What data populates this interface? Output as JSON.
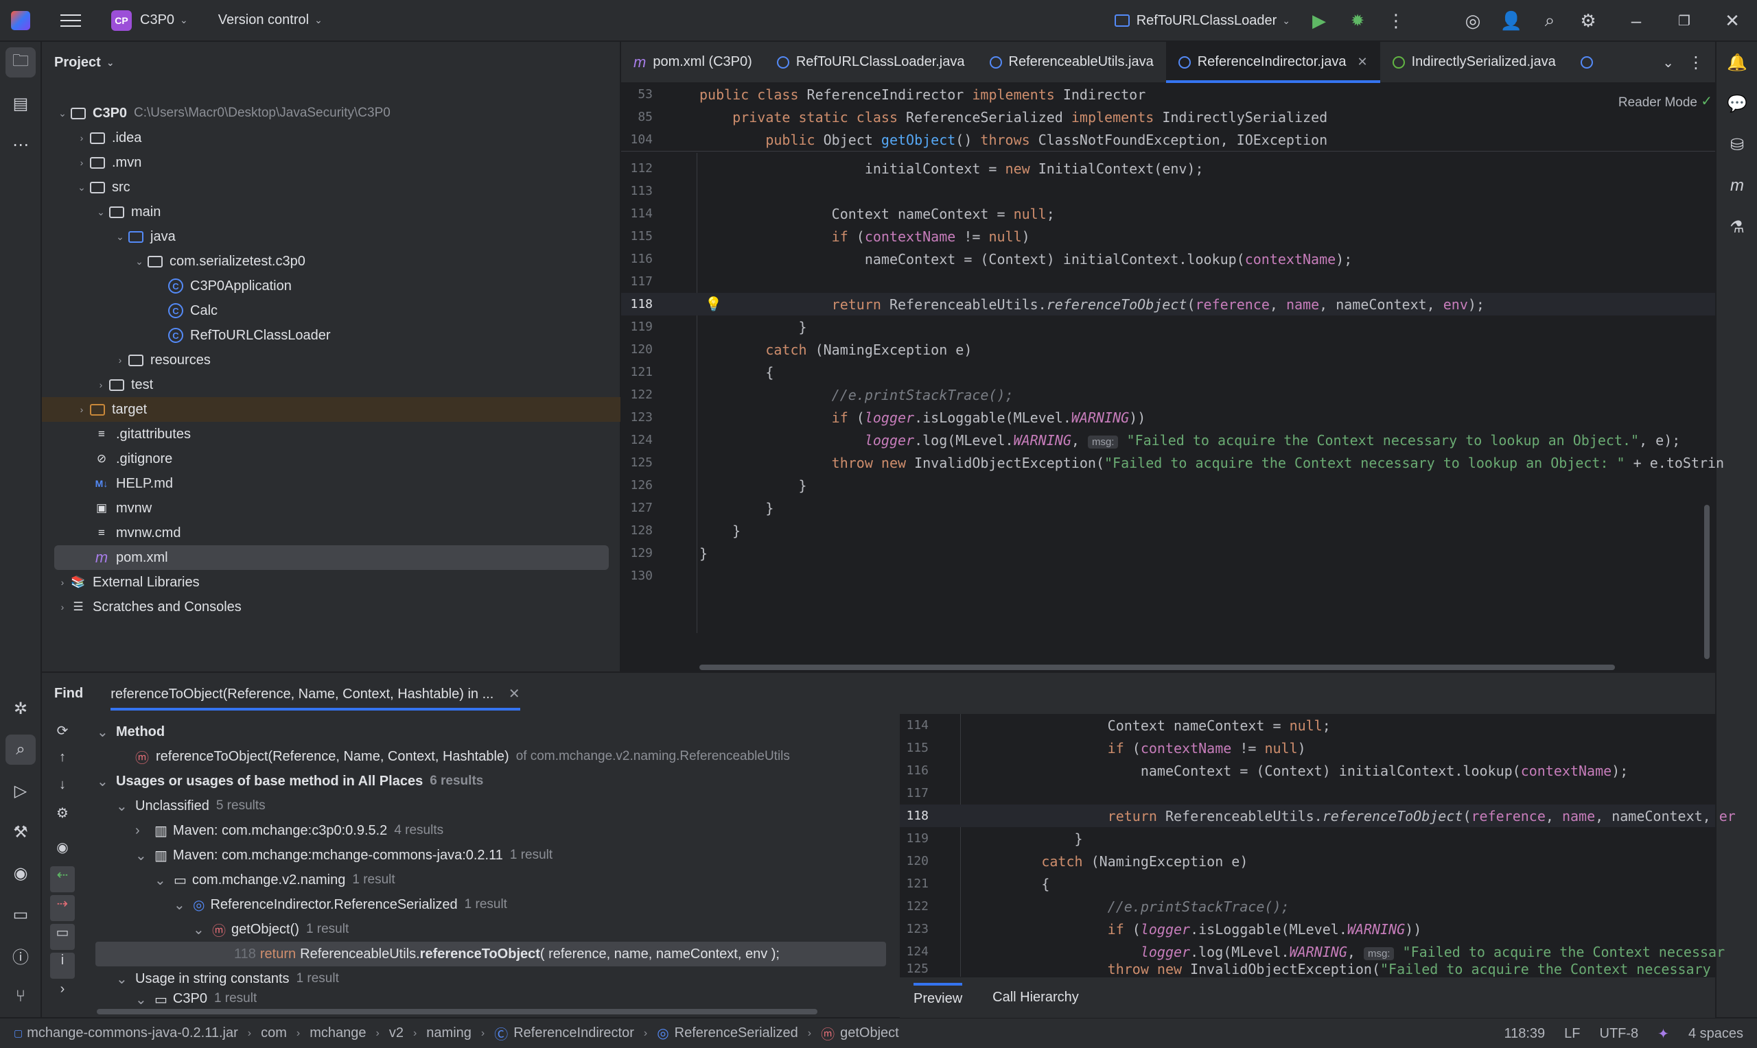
{
  "titlebar": {
    "project_badge": "CP",
    "project_name": "C3P0",
    "vcs": "Version control",
    "run_config": "RefToURLClassLoader"
  },
  "project_panel": {
    "title": "Project",
    "root_name": "C3P0",
    "root_path": "C:\\Users\\Macr0\\Desktop\\JavaSecurity\\C3P0",
    "items": [
      {
        "label": ".idea"
      },
      {
        "label": ".mvn"
      },
      {
        "label": "src"
      },
      {
        "label": "main"
      },
      {
        "label": "java"
      },
      {
        "label": "com.serializetest.c3p0"
      },
      {
        "label": "C3P0Application"
      },
      {
        "label": "Calc"
      },
      {
        "label": "RefToURLClassLoader"
      },
      {
        "label": "resources"
      },
      {
        "label": "test"
      },
      {
        "label": "target"
      },
      {
        "label": ".gitattributes"
      },
      {
        "label": ".gitignore"
      },
      {
        "label": "HELP.md"
      },
      {
        "label": "mvnw"
      },
      {
        "label": "mvnw.cmd"
      },
      {
        "label": "pom.xml"
      },
      {
        "label": "External Libraries"
      },
      {
        "label": "Scratches and Consoles"
      }
    ]
  },
  "editor": {
    "tabs": [
      {
        "label": "pom.xml (C3P0)"
      },
      {
        "label": "RefToURLClassLoader.java"
      },
      {
        "label": "ReferenceableUtils.java"
      },
      {
        "label": "ReferenceIndirector.java"
      },
      {
        "label": "IndirectlySerialized.java"
      }
    ],
    "reader_mode": "Reader Mode",
    "sticky": [
      {
        "ln": "53"
      },
      {
        "ln": "85"
      },
      {
        "ln": "104"
      }
    ],
    "line_numbers": [
      "112",
      "113",
      "114",
      "115",
      "116",
      "117",
      "118",
      "119",
      "120",
      "121",
      "122",
      "123",
      "124",
      "125",
      "126",
      "127",
      "128",
      "129",
      "130"
    ],
    "hint_msg": "msg:"
  },
  "find": {
    "title": "Find",
    "tab_label": "referenceToObject(Reference, Name, Context, Hashtable) in ...",
    "method_header": "Method",
    "method_sig": "referenceToObject(Reference, Name, Context, Hashtable)",
    "method_of": "of com.mchange.v2.naming.ReferenceableUtils",
    "usages_header": "Usages or usages of base method in All Places",
    "usages_count": "6 results",
    "unclassified": "Unclassified",
    "unclassified_count": "5 results",
    "maven1": "Maven: com.mchange:c3p0:0.9.5.2",
    "maven1_count": "4 results",
    "maven2": "Maven: com.mchange:mchange-commons-java:0.2.11",
    "maven2_count": "1 result",
    "pkg": "com.mchange.v2.naming",
    "pkg_count": "1 result",
    "cls": "ReferenceIndirector.ReferenceSerialized",
    "cls_count": "1 result",
    "method": "getObject()",
    "method_count": "1 result",
    "usage_ln": "118",
    "usage_text_a": "return",
    "usage_text_b": "ReferenceableUtils.",
    "usage_text_c": "referenceToObject",
    "usage_text_d": "( reference, name, nameContext, env );",
    "string_const": "Usage in string constants",
    "string_count": "1 result",
    "c3p0": "C3P0",
    "c3p0_count": "1 result",
    "preview_lines": [
      "114",
      "115",
      "116",
      "117",
      "118",
      "119",
      "120",
      "121",
      "122",
      "123",
      "124",
      "125"
    ],
    "preview_tab": "Preview",
    "hierarchy_tab": "Call Hierarchy"
  },
  "status": {
    "crumbs": [
      "mchange-commons-java-0.2.11.jar",
      "com",
      "mchange",
      "v2",
      "naming",
      "ReferenceIndirector",
      "ReferenceSerialized",
      "getObject"
    ],
    "position": "118:39",
    "line_sep": "LF",
    "encoding": "UTF-8",
    "indent": "4 spaces"
  }
}
